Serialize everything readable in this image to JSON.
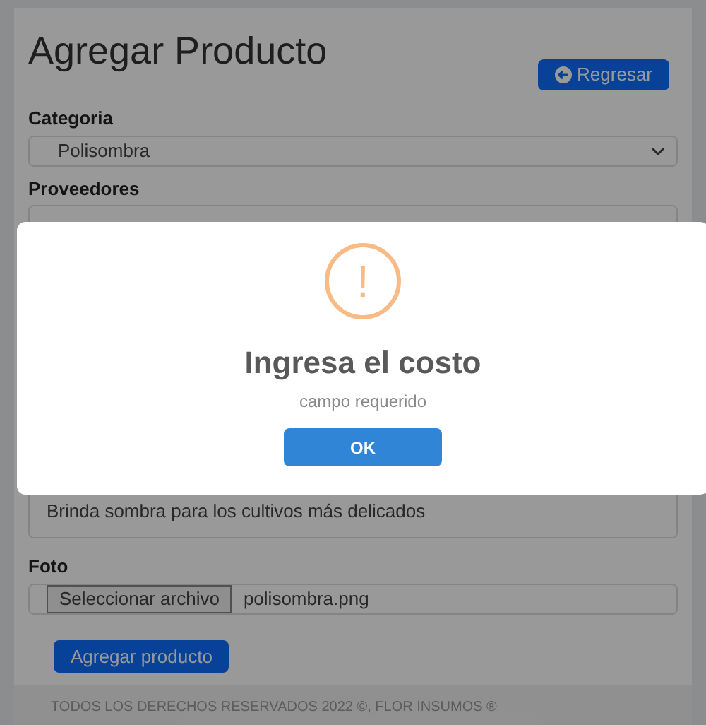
{
  "page": {
    "title": "Agregar Producto",
    "back_button": "Regresar"
  },
  "form": {
    "category": {
      "label": "Categoria",
      "value": "Polisombra"
    },
    "provider": {
      "label": "Proveedores"
    },
    "description": {
      "value": "Brinda sombra para los cultivos más delicados"
    },
    "photo": {
      "label": "Foto",
      "file_button": "Seleccionar archivo",
      "file_name": "polisombra.png"
    },
    "submit": "Agregar producto"
  },
  "footer": "TODOS LOS DERECHOS RESERVADOS 2022 ©, FLOR INSUMOS ®",
  "alert": {
    "icon": "!",
    "title": "Ingresa el costo",
    "text": "campo requerido",
    "confirm": "OK"
  }
}
